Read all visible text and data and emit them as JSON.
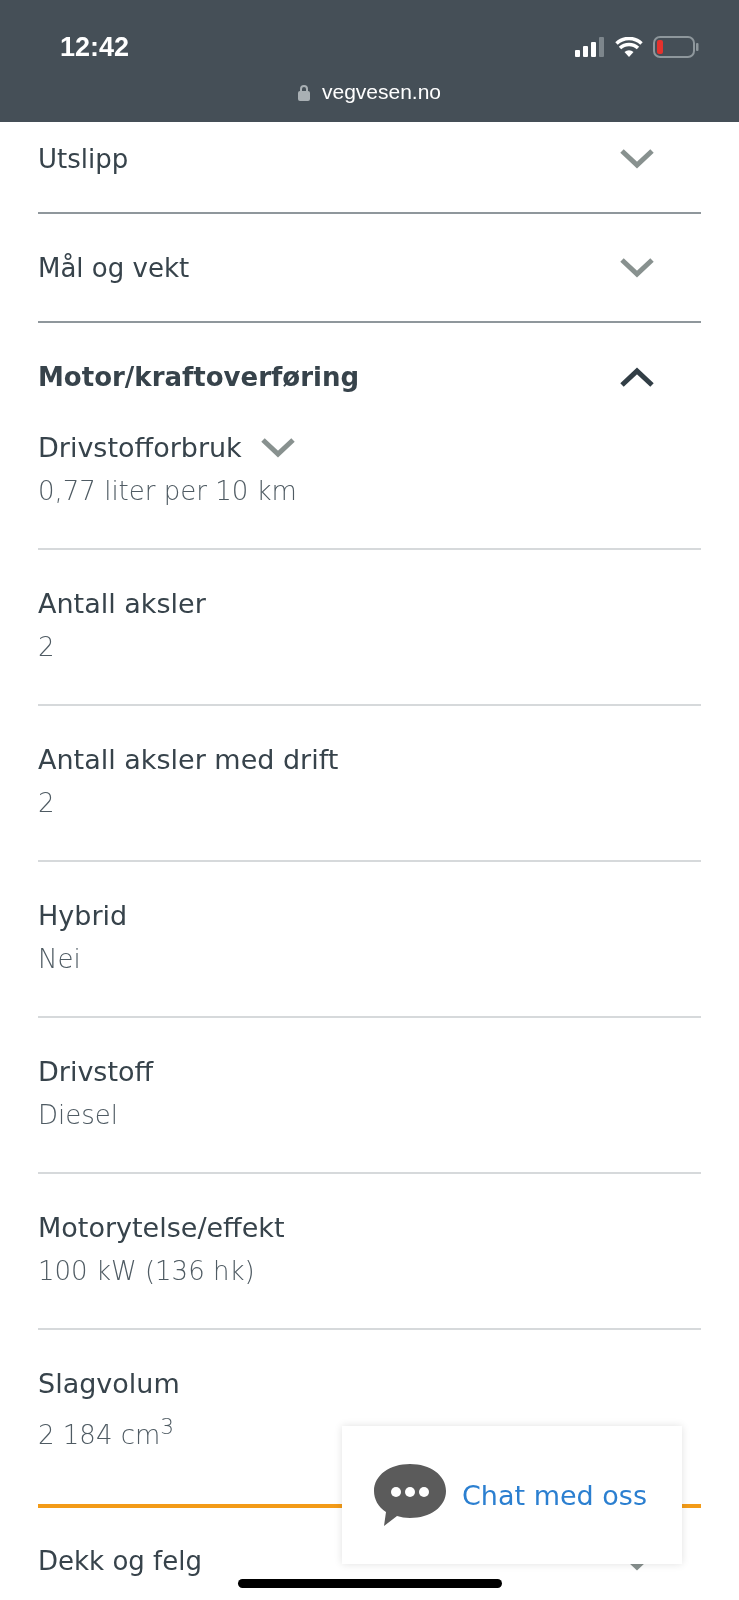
{
  "status_bar": {
    "time": "12:42",
    "url": "vegvesen.no"
  },
  "sections": [
    {
      "title": "Utslipp",
      "expanded": false
    },
    {
      "title": "Mål og vekt",
      "expanded": false
    },
    {
      "title": "Motor/kraftoverføring",
      "expanded": true,
      "fields": [
        {
          "label": "Drivstofforbruk",
          "value": "0,77 liter per 10 km",
          "expandable": true
        },
        {
          "label": "Antall aksler",
          "value": "2",
          "expandable": false
        },
        {
          "label": "Antall aksler med drift",
          "value": "2",
          "expandable": false
        },
        {
          "label": "Hybrid",
          "value": "Nei",
          "expandable": false
        },
        {
          "label": "Drivstoff",
          "value": "Diesel",
          "expandable": false
        },
        {
          "label": "Motorytelse/effekt",
          "value": "100 kW (136 hk)",
          "expandable": false
        },
        {
          "label": "Slagvolum",
          "value": "2 184 cm$^{3}$",
          "expandable": false
        }
      ]
    },
    {
      "title": "Dekk og felg",
      "expanded": false
    }
  ],
  "chat": {
    "label": "Chat med oss"
  }
}
